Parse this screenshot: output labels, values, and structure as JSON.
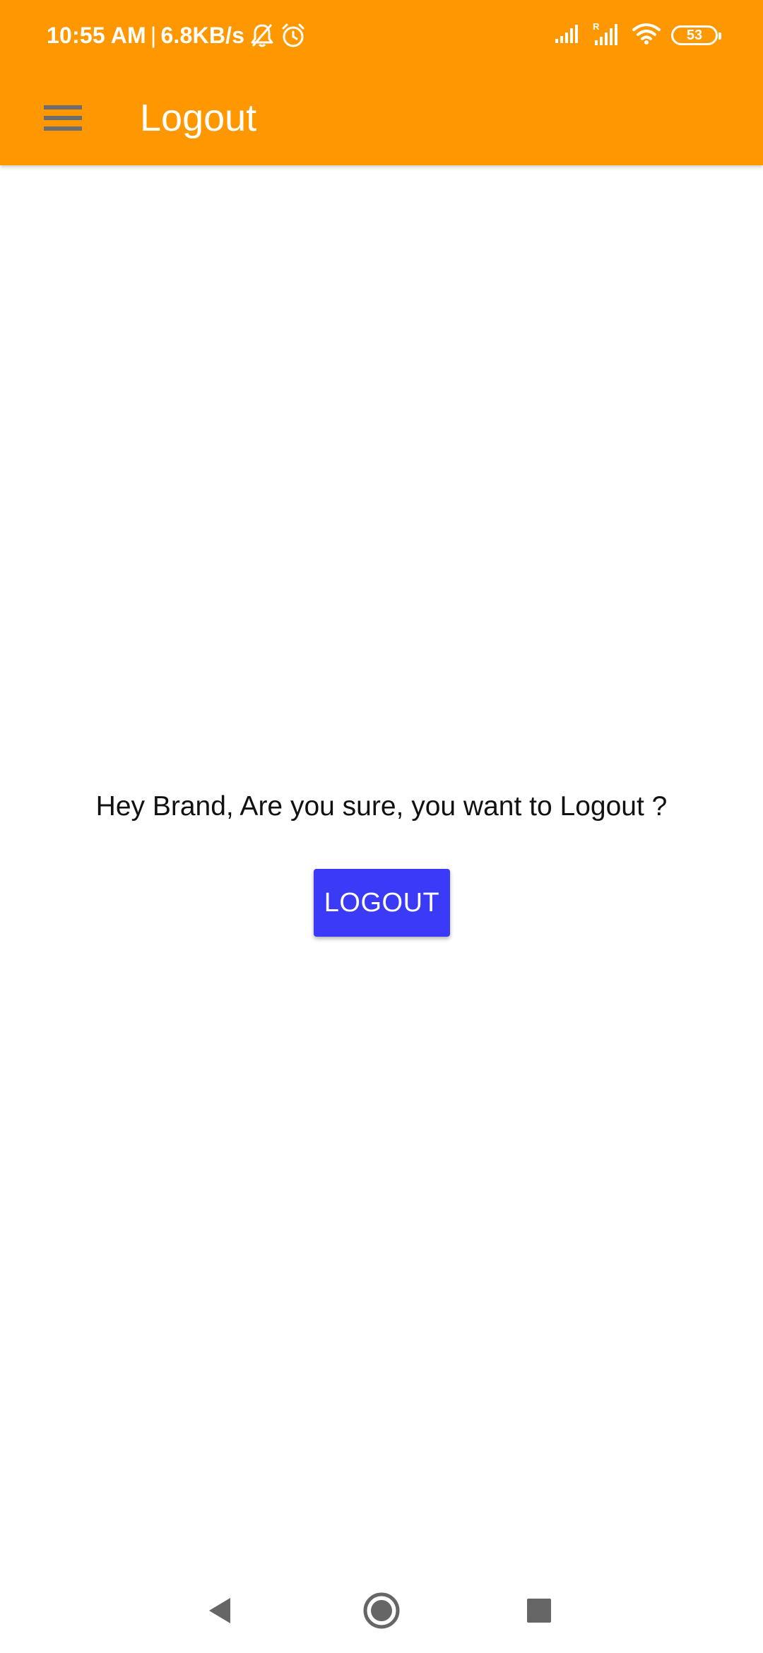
{
  "status_bar": {
    "time": "10:55 AM",
    "separator": "|",
    "network_speed": "6.8KB/s",
    "battery_level": "53",
    "icons": [
      "bell-off-icon",
      "alarm-icon",
      "signal-icon",
      "signal-roaming-icon",
      "wifi-icon",
      "battery-icon"
    ]
  },
  "app_bar": {
    "title": "Logout",
    "menu_icon": "hamburger-menu-icon",
    "background_color": "#ff9800"
  },
  "main": {
    "prompt_text": "Hey Brand, Are you sure, you want to Logout ?",
    "logout_button_label": "LOGOUT",
    "button_color": "#3a3af7"
  },
  "nav_bar": {
    "icons": [
      "back-icon",
      "home-icon",
      "recent-apps-icon"
    ]
  }
}
